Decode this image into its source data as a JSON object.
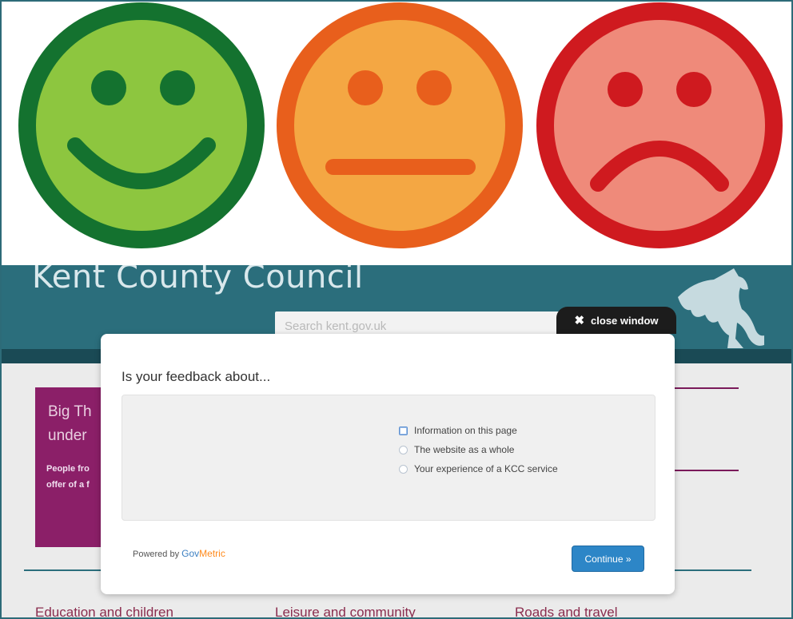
{
  "faces": [
    {
      "name": "happy-face-icon",
      "mood": "happy",
      "fill": "#8dc63f",
      "stroke": "#14722f"
    },
    {
      "name": "neutral-face-icon",
      "mood": "neutral",
      "fill": "#f4a743",
      "stroke": "#e85f1c"
    },
    {
      "name": "sad-face-icon",
      "mood": "sad",
      "fill": "#ef8a7a",
      "stroke": "#cf1a1f"
    }
  ],
  "site": {
    "title": "Kent County Council",
    "search_placeholder": "Search kent.gov.uk",
    "promo_heading": "Big Th\nunder",
    "promo_text": "People fro\noffer of a f",
    "nav": [
      "Education and children",
      "Leisure and community",
      "Roads and travel"
    ]
  },
  "modal": {
    "close_label": "close window",
    "title": "Is your feedback about...",
    "options": [
      {
        "label": "Information on this page",
        "type": "checkbox"
      },
      {
        "label": "The website as a whole",
        "type": "radio"
      },
      {
        "label": "Your experience of a KCC service",
        "type": "radio"
      }
    ],
    "powered_by": "Powered by",
    "brand_gov": "Gov",
    "brand_metric": "Metric",
    "continue_label": "Continue »"
  },
  "colors": {
    "header_teal": "#2b6e7c",
    "promo_purple": "#8b1f68",
    "button_blue": "#2d86c7"
  }
}
